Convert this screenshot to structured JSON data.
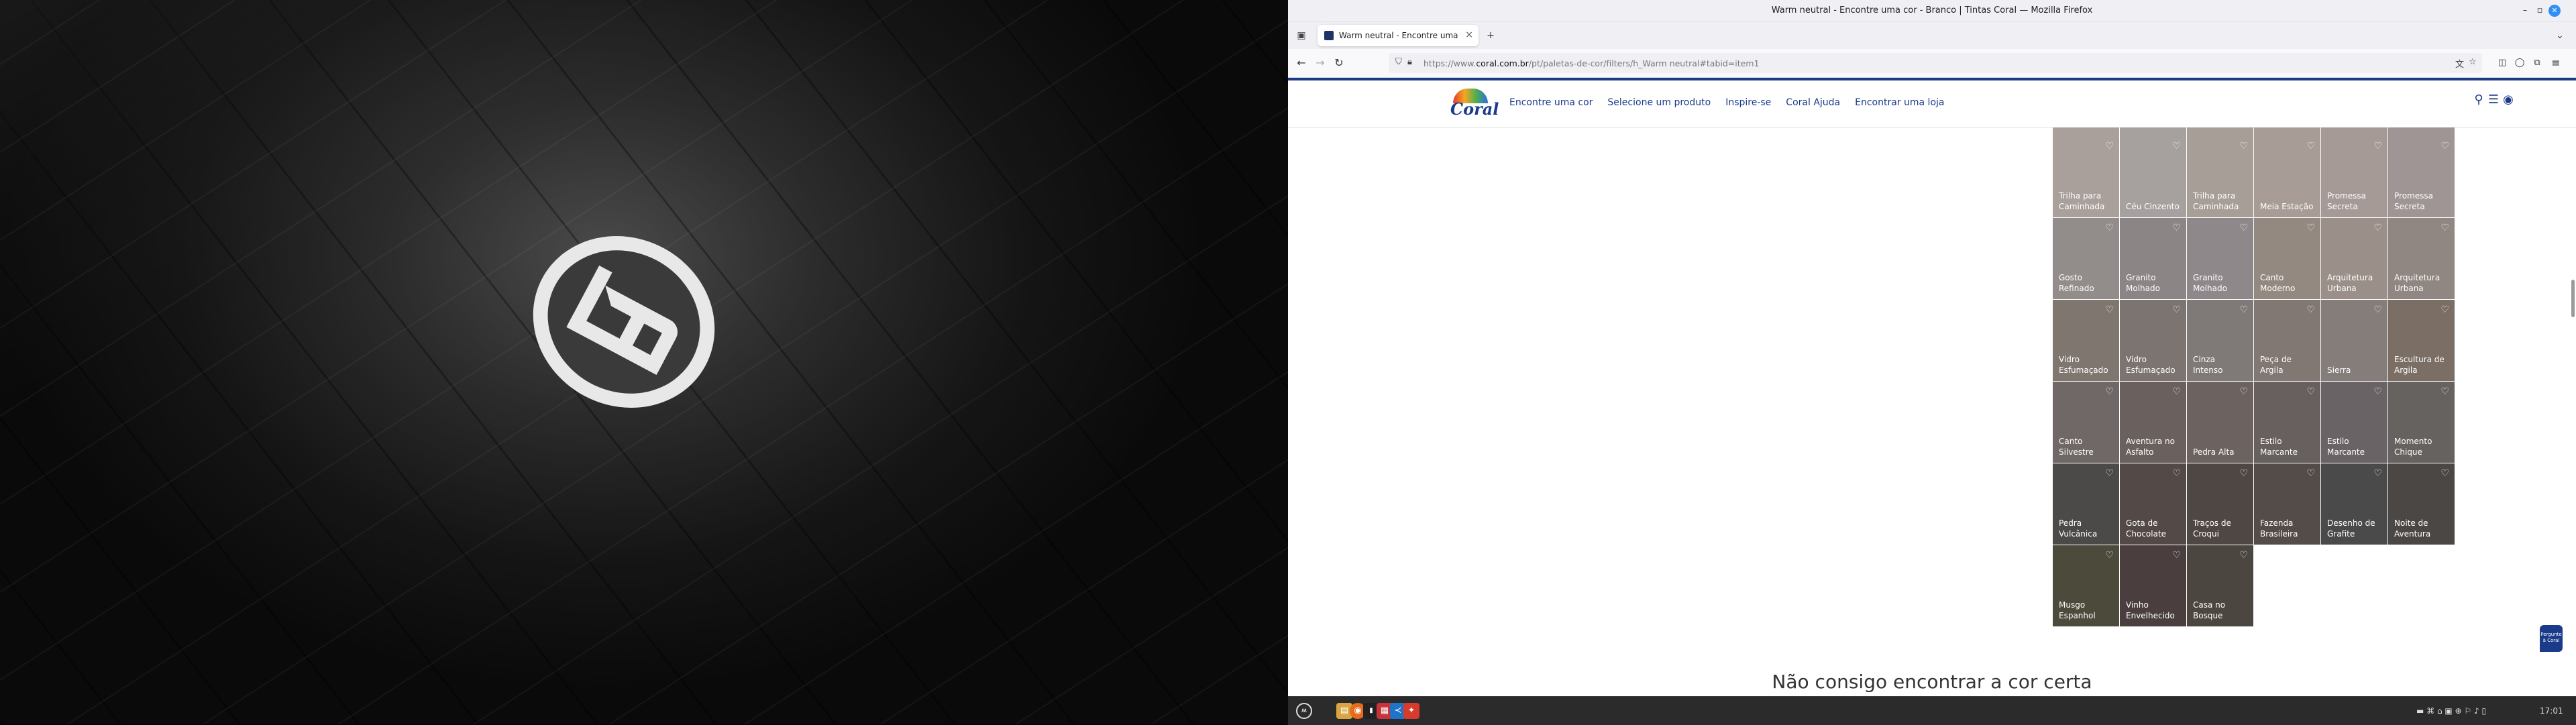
{
  "window": {
    "title": "Warm neutral - Encontre uma cor - Branco | Tintas Coral — Mozilla Firefox"
  },
  "tab": {
    "label": "Warm neutral - Encontre uma cor",
    "close": "×"
  },
  "url": {
    "prefix": "https://www.",
    "domain": "coral.com.br",
    "path": "/pt/paletas-de-cor/filters/h_Warm neutral#tabid=item1"
  },
  "nav": {
    "items": [
      "Encontre uma cor",
      "Selecione um produto",
      "Inspire-se",
      "Coral Ajuda",
      "Encontrar uma loja"
    ]
  },
  "logo": {
    "text": "Coral"
  },
  "colors": {
    "tiles": [
      "#a9a09c",
      "#a6a19f",
      "#a79e98",
      "#a89d96",
      "#a69a97",
      "#a09595",
      "#928c8a",
      "#8c8586",
      "#8f888b",
      "#938981",
      "#9a9089",
      "#908682",
      "#807670",
      "#7c7471",
      "#7f7a77",
      "#817773",
      "#857d79",
      "#7b6e64",
      "#6f6866",
      "#6a615e",
      "#6c6360",
      "#67605f",
      "#6a6365",
      "#66625f",
      "#4c4a49",
      "#534946",
      "#4e4744",
      "#544c49",
      "#4b4a4a",
      "#4b4745",
      "#4c4a3b",
      "#4a3f3e",
      "#4c4640"
    ],
    "accent": "#1a3a8a"
  },
  "tiles": [
    {
      "name": "Trilha para Caminhada"
    },
    {
      "name": "Céu Cinzento"
    },
    {
      "name": "Trilha para Caminhada"
    },
    {
      "name": "Meia Estação"
    },
    {
      "name": "Promessa Secreta"
    },
    {
      "name": "Promessa Secreta"
    },
    {
      "name": "Gosto Refinado"
    },
    {
      "name": "Granito Molhado"
    },
    {
      "name": "Granito Molhado"
    },
    {
      "name": "Canto Moderno"
    },
    {
      "name": "Arquitetura Urbana"
    },
    {
      "name": "Arquitetura Urbana"
    },
    {
      "name": "Vidro Esfumaçado"
    },
    {
      "name": "Vidro Esfumaçado"
    },
    {
      "name": "Cinza Intenso"
    },
    {
      "name": "Peça de Argila"
    },
    {
      "name": "Sierra"
    },
    {
      "name": "Escultura de Argila"
    },
    {
      "name": "Canto Silvestre"
    },
    {
      "name": "Aventura no Asfalto"
    },
    {
      "name": "Pedra Alta"
    },
    {
      "name": "Estilo Marcante"
    },
    {
      "name": "Estilo Marcante"
    },
    {
      "name": "Momento Chique"
    },
    {
      "name": "Pedra Vulcânica"
    },
    {
      "name": "Gota de Chocolate"
    },
    {
      "name": "Traços de Croqui"
    },
    {
      "name": "Fazenda Brasileira"
    },
    {
      "name": "Desenho de Grafite"
    },
    {
      "name": "Noite de Aventura"
    },
    {
      "name": "Musgo Espanhol"
    },
    {
      "name": "Vinho Envelhecido"
    },
    {
      "name": "Casa no Bosque"
    }
  ],
  "cta": "Não consigo encontrar a cor certa",
  "chat": {
    "label": "Pergunte à Coral"
  },
  "taskbar": {
    "clock": "17:01"
  },
  "icons": {
    "heart": "heart-icon",
    "search": "search-icon",
    "list": "list-icon",
    "user": "user-icon"
  }
}
